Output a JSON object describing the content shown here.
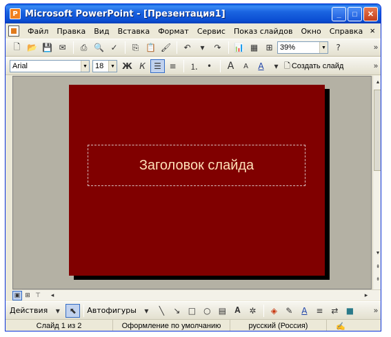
{
  "window": {
    "title": "Microsoft PowerPoint - [Презентация1]",
    "app_icon_letter": "P",
    "minimize": "_",
    "maximize": "□",
    "close": "✕"
  },
  "menu": {
    "items": [
      "Файл",
      "Правка",
      "Вид",
      "Вставка",
      "Формат",
      "Сервис",
      "Показ слайдов",
      "Окно",
      "Справка"
    ],
    "close": "×"
  },
  "toolbar1": {
    "zoom": "39%",
    "help": "?"
  },
  "toolbar2": {
    "font": "Arial",
    "size": "18",
    "bold": "Ж",
    "italic": "К",
    "create_slide": "Создать слайд"
  },
  "slide": {
    "title": "Заголовок слайда",
    "background": "#800000",
    "text_color": "#ffe0b8"
  },
  "drawing": {
    "actions": "Действия",
    "autoshapes": "Автофигуры"
  },
  "status": {
    "slide": "Слайд 1 из 2",
    "design": "Оформление по умолчанию",
    "language": "русский (Россия)"
  }
}
